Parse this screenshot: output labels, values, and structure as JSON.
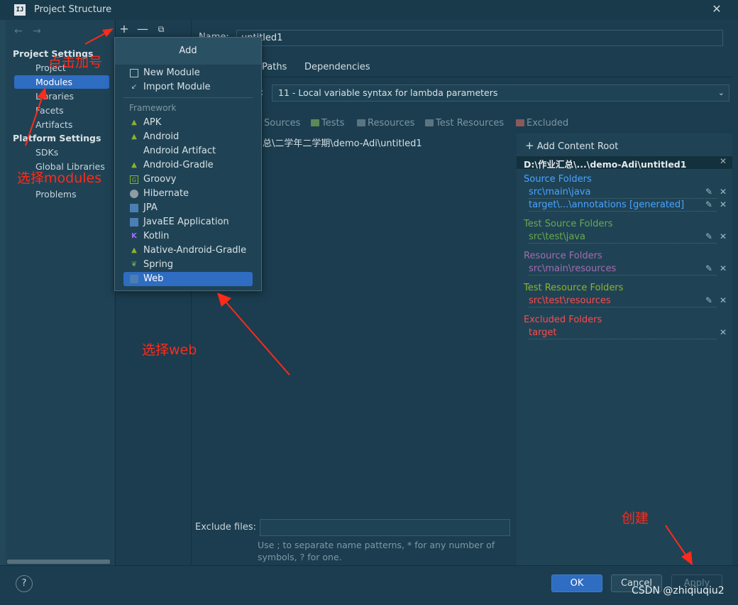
{
  "window": {
    "title": "Project Structure",
    "logo": "IJ"
  },
  "nav": {
    "project_settings": "Project Settings",
    "items_ps": [
      "Project",
      "Modules",
      "Libraries",
      "Facets",
      "Artifacts"
    ],
    "platform_settings": "Platform Settings",
    "items_pl": [
      "SDKs",
      "Global Libraries"
    ],
    "problems": "Problems"
  },
  "module": {
    "name_label": "Name:",
    "name_value": "untitled1",
    "tabs": [
      "Paths",
      "Dependencies"
    ],
    "language_level": "11 - Local variable syntax for lambda parameters",
    "mark_as": [
      "Sources",
      "Tests",
      "Resources",
      "Test Resources",
      "Excluded"
    ],
    "path": "总\\二学年二学期\\demo-Adi\\untitled1"
  },
  "roots": {
    "add": "Add Content Root",
    "root": "D:\\作业汇总\\...\\demo-Adi\\untitled1",
    "source_title": "Source Folders",
    "source_items": [
      "src\\main\\java",
      "target\\...\\annotations [generated]"
    ],
    "test_title": "Test Source Folders",
    "test_items": [
      "src\\test\\java"
    ],
    "resource_title": "Resource Folders",
    "resource_items": [
      "src\\main\\resources"
    ],
    "test_resource_title": "Test Resource Folders",
    "test_resource_items": [
      "src\\test\\resources"
    ],
    "excluded_title": "Excluded Folders",
    "excluded_items": [
      "target"
    ]
  },
  "exclude": {
    "label": "Exclude files:",
    "hint": "Use ; to separate name patterns, * for any number of symbols, ? for one."
  },
  "buttons": {
    "ok": "OK",
    "cancel": "Cancel",
    "apply": "Apply",
    "help": "?"
  },
  "popup": {
    "title": "Add",
    "top_items": [
      "New Module",
      "Import Module"
    ],
    "framework_label": "Framework",
    "framework_items": [
      "APK",
      "Android",
      "Android Artifact",
      "Android-Gradle",
      "Groovy",
      "Hibernate",
      "JPA",
      "JavaEE Application",
      "Kotlin",
      "Native-Android-Gradle",
      "Spring",
      "Web"
    ]
  },
  "annotations": {
    "plus": "点击加号",
    "modules": "选择modules",
    "web": "选择web",
    "create": "创建"
  },
  "watermark": "CSDN @zhiqiuqiu2",
  "colors": {
    "background": "#1b3d4f",
    "selection": "#2e6dc1",
    "source": "#4aa3ff",
    "test": "#6aa84f",
    "resource": "#a36cb0",
    "test_resource": "#8fb22a",
    "excluded": "#ff4a4a",
    "annotation": "#ff2a1a"
  }
}
